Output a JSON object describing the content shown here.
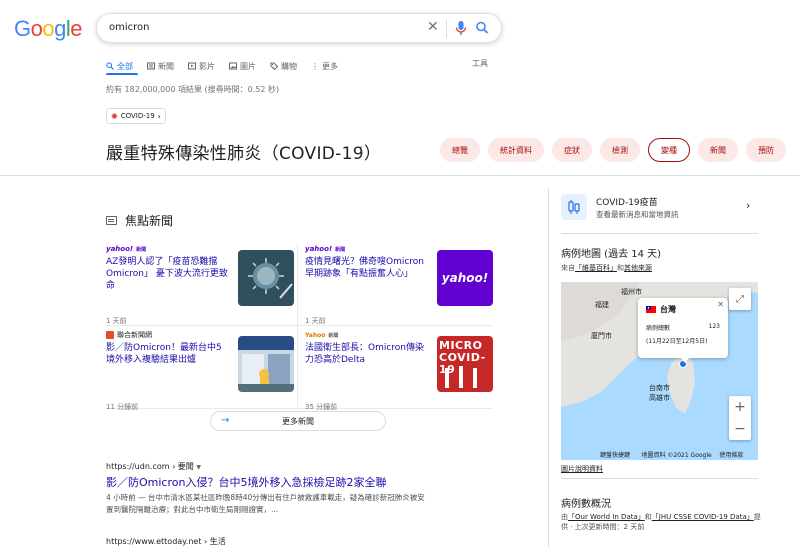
{
  "logo": {
    "letters": [
      "G",
      "o",
      "o",
      "g",
      "l",
      "e"
    ],
    "colors": [
      "#4285F4",
      "#EA4335",
      "#FBBC05",
      "#4285F4",
      "#34A853",
      "#EA4335"
    ]
  },
  "search": {
    "query": "omicron",
    "clear_icon": "close-icon",
    "mic_icon": "mic-icon",
    "search_icon": "search-icon"
  },
  "tabs": [
    {
      "label": "全部",
      "icon": "search-icon",
      "active": true
    },
    {
      "label": "新聞",
      "icon": "newspaper-icon"
    },
    {
      "label": "影片",
      "icon": "video-icon"
    },
    {
      "label": "圖片",
      "icon": "image-icon"
    },
    {
      "label": "購物",
      "icon": "tag-icon"
    },
    {
      "label": "更多",
      "icon": "more-vert-icon"
    }
  ],
  "tools_label": "工具",
  "result_stats": "約有 182,000,000 項結果 (搜尋時間：0.52 秒)",
  "covid_chip": "COVID-19",
  "topic_title": "嚴重特殊傳染性肺炎（COVID-19）",
  "topic_pills": [
    {
      "label": "總覽"
    },
    {
      "label": "統計資料"
    },
    {
      "label": "症狀"
    },
    {
      "label": "檢測"
    },
    {
      "label": "變種",
      "selected": true
    },
    {
      "label": "新聞"
    },
    {
      "label": "預防"
    }
  ],
  "top_stories": {
    "heading": "焦點新聞",
    "cards": [
      {
        "source": "yahoo!",
        "source_sub": "新聞",
        "headline": "AZ發明人認了「疫苗恐難擋Omicron」 憂下波大流行更致命",
        "time": "1 天前"
      },
      {
        "source": "yahoo!",
        "source_sub": "新聞",
        "headline": "疫情見曙光？佛奇嗖Omicron早期跡象「有點振奮人心」",
        "time": "1 天前",
        "thumb_text": "yahoo!"
      },
      {
        "source": "聯合新聞網",
        "headline": "影／防Omicron！最新台中5境外移入複驗結果出爐",
        "time": "11 分鐘前"
      },
      {
        "source": "Yahoo",
        "source_sub": "新聞",
        "headline": "法國衛生部長：Omicron傳染力恐高於Delta",
        "time": "35 分鐘前",
        "thumb_text": "MICRO COVID-19"
      }
    ],
    "more_label": "更多新聞"
  },
  "results": [
    {
      "url": "https://udn.com › 要聞",
      "title": "影／防Omicron入侵？台中5境外移入急採檢足跡2家全聯",
      "snippet_line1": "4 小時前 — 台中市清水區某社區昨晚8時40分傳出有住戶被救護車載走，疑為確診新冠肺炎被安",
      "snippet_line2": "置到醫院隔離治療；對此台中市衛生局剛剛證實，..."
    },
    {
      "url": "https://www.ettoday.net › 生活"
    }
  ],
  "right_panel": {
    "vaccine": {
      "title": "COVID-19疫苗",
      "subtitle": "查看最新消息和當地資訊"
    },
    "map": {
      "title": "病例地圖 (過去 14 天)",
      "source_prefix": "來自",
      "source_link": "「維基百科」",
      "source_mid": "和",
      "source_link2": "其他來源",
      "labels": {
        "fuzhou": "福州市",
        "fujian": "福建",
        "xiamen": "廈門市",
        "tainan": "台南市",
        "kaohsiung": "高雄市"
      },
      "popup": {
        "region": "台灣",
        "case_label": "病例總數",
        "case_value": "123",
        "date_range": "(11月22日至12月5日)"
      },
      "footer_shortcuts": "鍵盤快捷鍵",
      "footer_data": "地圖資料 ©2021 Google",
      "footer_terms": "使用條款",
      "map_link": "圖片說明資料"
    },
    "cases": {
      "title": "病例數概況",
      "line1_prefix": "由",
      "link1": "「Our World In Data」",
      "line1_mid": "和",
      "link2": "「JHU CSSE COVID-19 Data」",
      "line1_suffix": "提",
      "line2": "供 · 上次更新時間：2 天前"
    }
  }
}
